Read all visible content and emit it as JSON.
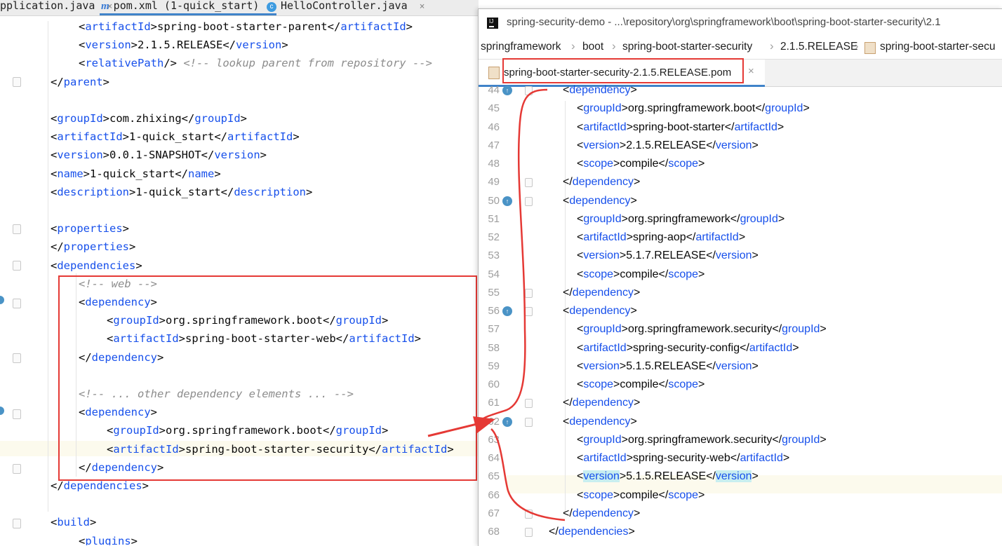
{
  "left_tabs": [
    {
      "label": "pplication.java",
      "icon": "",
      "close": "×"
    },
    {
      "label": "pom.xml (1-quick_start)",
      "icon": "m",
      "close": "×",
      "active": true
    },
    {
      "label": "HelloController.java",
      "icon": "c",
      "close": "×"
    }
  ],
  "left_code": [
    {
      "indent": 2,
      "kind": "elem",
      "tag": "artifactId",
      "text": "spring-boot-starter-parent"
    },
    {
      "indent": 2,
      "kind": "elem",
      "tag": "version",
      "text": "2.1.5.RELEASE"
    },
    {
      "indent": 2,
      "kind": "selfclose",
      "tag": "relativePath",
      "comment": "<!-- lookup parent from repository -->"
    },
    {
      "indent": 1,
      "kind": "close",
      "tag": "parent"
    },
    {
      "indent": 0,
      "kind": "blank"
    },
    {
      "indent": 1,
      "kind": "elem",
      "tag": "groupId",
      "text": "com.zhixing"
    },
    {
      "indent": 1,
      "kind": "elem",
      "tag": "artifactId",
      "text": "1-quick_start"
    },
    {
      "indent": 1,
      "kind": "elem",
      "tag": "version",
      "text": "0.0.1-SNAPSHOT"
    },
    {
      "indent": 1,
      "kind": "elem",
      "tag": "name",
      "text": "1-quick_start"
    },
    {
      "indent": 1,
      "kind": "elem",
      "tag": "description",
      "text": "1-quick_start"
    },
    {
      "indent": 0,
      "kind": "blank"
    },
    {
      "indent": 1,
      "kind": "open",
      "tag": "properties"
    },
    {
      "indent": 1,
      "kind": "close",
      "tag": "properties"
    },
    {
      "indent": 1,
      "kind": "open",
      "tag": "dependencies"
    },
    {
      "indent": 2,
      "kind": "comment",
      "comment": "<!-- web -->"
    },
    {
      "indent": 2,
      "kind": "open",
      "tag": "dependency"
    },
    {
      "indent": 3,
      "kind": "elem",
      "tag": "groupId",
      "text": "org.springframework.boot"
    },
    {
      "indent": 3,
      "kind": "elem",
      "tag": "artifactId",
      "text": "spring-boot-starter-web"
    },
    {
      "indent": 2,
      "kind": "close",
      "tag": "dependency"
    },
    {
      "indent": 0,
      "kind": "blank"
    },
    {
      "indent": 2,
      "kind": "comment",
      "comment": "<!-- ... other dependency elements ... -->"
    },
    {
      "indent": 2,
      "kind": "open",
      "tag": "dependency"
    },
    {
      "indent": 3,
      "kind": "elem",
      "tag": "groupId",
      "text": "org.springframework.boot"
    },
    {
      "indent": 3,
      "kind": "elem",
      "tag": "artifactId",
      "text": "spring-boot-starter-security"
    },
    {
      "indent": 2,
      "kind": "close",
      "tag": "dependency"
    },
    {
      "indent": 1,
      "kind": "close",
      "tag": "dependencies"
    },
    {
      "indent": 0,
      "kind": "blank"
    },
    {
      "indent": 1,
      "kind": "open",
      "tag": "build"
    },
    {
      "indent": 2,
      "kind": "open",
      "tag": "plugins"
    }
  ],
  "popup": {
    "title": "spring-security-demo - ...\\repository\\org\\springframework\\boot\\spring-boot-starter-security\\2.1",
    "breadcrumbs": [
      "springframework",
      "boot",
      "spring-boot-starter-security",
      "2.1.5.RELEASE",
      "spring-boot-starter-secu"
    ],
    "tab_label": "spring-boot-starter-security-2.1.5.RELEASE.pom",
    "tab_close": "×",
    "lines": [
      {
        "n": "44",
        "indent": 1,
        "kind": "open",
        "tag": "dependency",
        "marker": true
      },
      {
        "n": "45",
        "indent": 2,
        "kind": "elem",
        "tag": "groupId",
        "text": "org.springframework.boot"
      },
      {
        "n": "46",
        "indent": 2,
        "kind": "elem",
        "tag": "artifactId",
        "text": "spring-boot-starter"
      },
      {
        "n": "47",
        "indent": 2,
        "kind": "elem",
        "tag": "version",
        "text": "2.1.5.RELEASE"
      },
      {
        "n": "48",
        "indent": 2,
        "kind": "elem",
        "tag": "scope",
        "text": "compile"
      },
      {
        "n": "49",
        "indent": 1,
        "kind": "close",
        "tag": "dependency"
      },
      {
        "n": "50",
        "indent": 1,
        "kind": "open",
        "tag": "dependency",
        "marker": true
      },
      {
        "n": "51",
        "indent": 2,
        "kind": "elem",
        "tag": "groupId",
        "text": "org.springframework"
      },
      {
        "n": "52",
        "indent": 2,
        "kind": "elem",
        "tag": "artifactId",
        "text": "spring-aop"
      },
      {
        "n": "53",
        "indent": 2,
        "kind": "elem",
        "tag": "version",
        "text": "5.1.7.RELEASE"
      },
      {
        "n": "54",
        "indent": 2,
        "kind": "elem",
        "tag": "scope",
        "text": "compile"
      },
      {
        "n": "55",
        "indent": 1,
        "kind": "close",
        "tag": "dependency"
      },
      {
        "n": "56",
        "indent": 1,
        "kind": "open",
        "tag": "dependency",
        "marker": true
      },
      {
        "n": "57",
        "indent": 2,
        "kind": "elem",
        "tag": "groupId",
        "text": "org.springframework.security"
      },
      {
        "n": "58",
        "indent": 2,
        "kind": "elem",
        "tag": "artifactId",
        "text": "spring-security-config"
      },
      {
        "n": "59",
        "indent": 2,
        "kind": "elem",
        "tag": "version",
        "text": "5.1.5.RELEASE"
      },
      {
        "n": "60",
        "indent": 2,
        "kind": "elem",
        "tag": "scope",
        "text": "compile"
      },
      {
        "n": "61",
        "indent": 1,
        "kind": "close",
        "tag": "dependency"
      },
      {
        "n": "62",
        "indent": 1,
        "kind": "open",
        "tag": "dependency",
        "marker": true
      },
      {
        "n": "63",
        "indent": 2,
        "kind": "elem",
        "tag": "groupId",
        "text": "org.springframework.security"
      },
      {
        "n": "64",
        "indent": 2,
        "kind": "elem",
        "tag": "artifactId",
        "text": "spring-security-web"
      },
      {
        "n": "65",
        "indent": 2,
        "kind": "elem",
        "tag": "version",
        "text": "5.1.5.RELEASE",
        "current": true
      },
      {
        "n": "66",
        "indent": 2,
        "kind": "elem",
        "tag": "scope",
        "text": "compile"
      },
      {
        "n": "67",
        "indent": 1,
        "kind": "close",
        "tag": "dependency"
      },
      {
        "n": "68",
        "indent": 0,
        "kind": "close",
        "tag": "dependencies"
      }
    ]
  },
  "colors": {
    "tag": "#1750eb",
    "comment": "#8c8c8c",
    "annotation": "#e53935",
    "tab_accent": "#4083c9",
    "current_line": "#fcfaed"
  },
  "icons": {
    "maven": "m-icon",
    "class": "c-icon",
    "app": "intellij-logo-icon",
    "pom_file": "pom-file-icon",
    "override": "override-marker-icon"
  }
}
